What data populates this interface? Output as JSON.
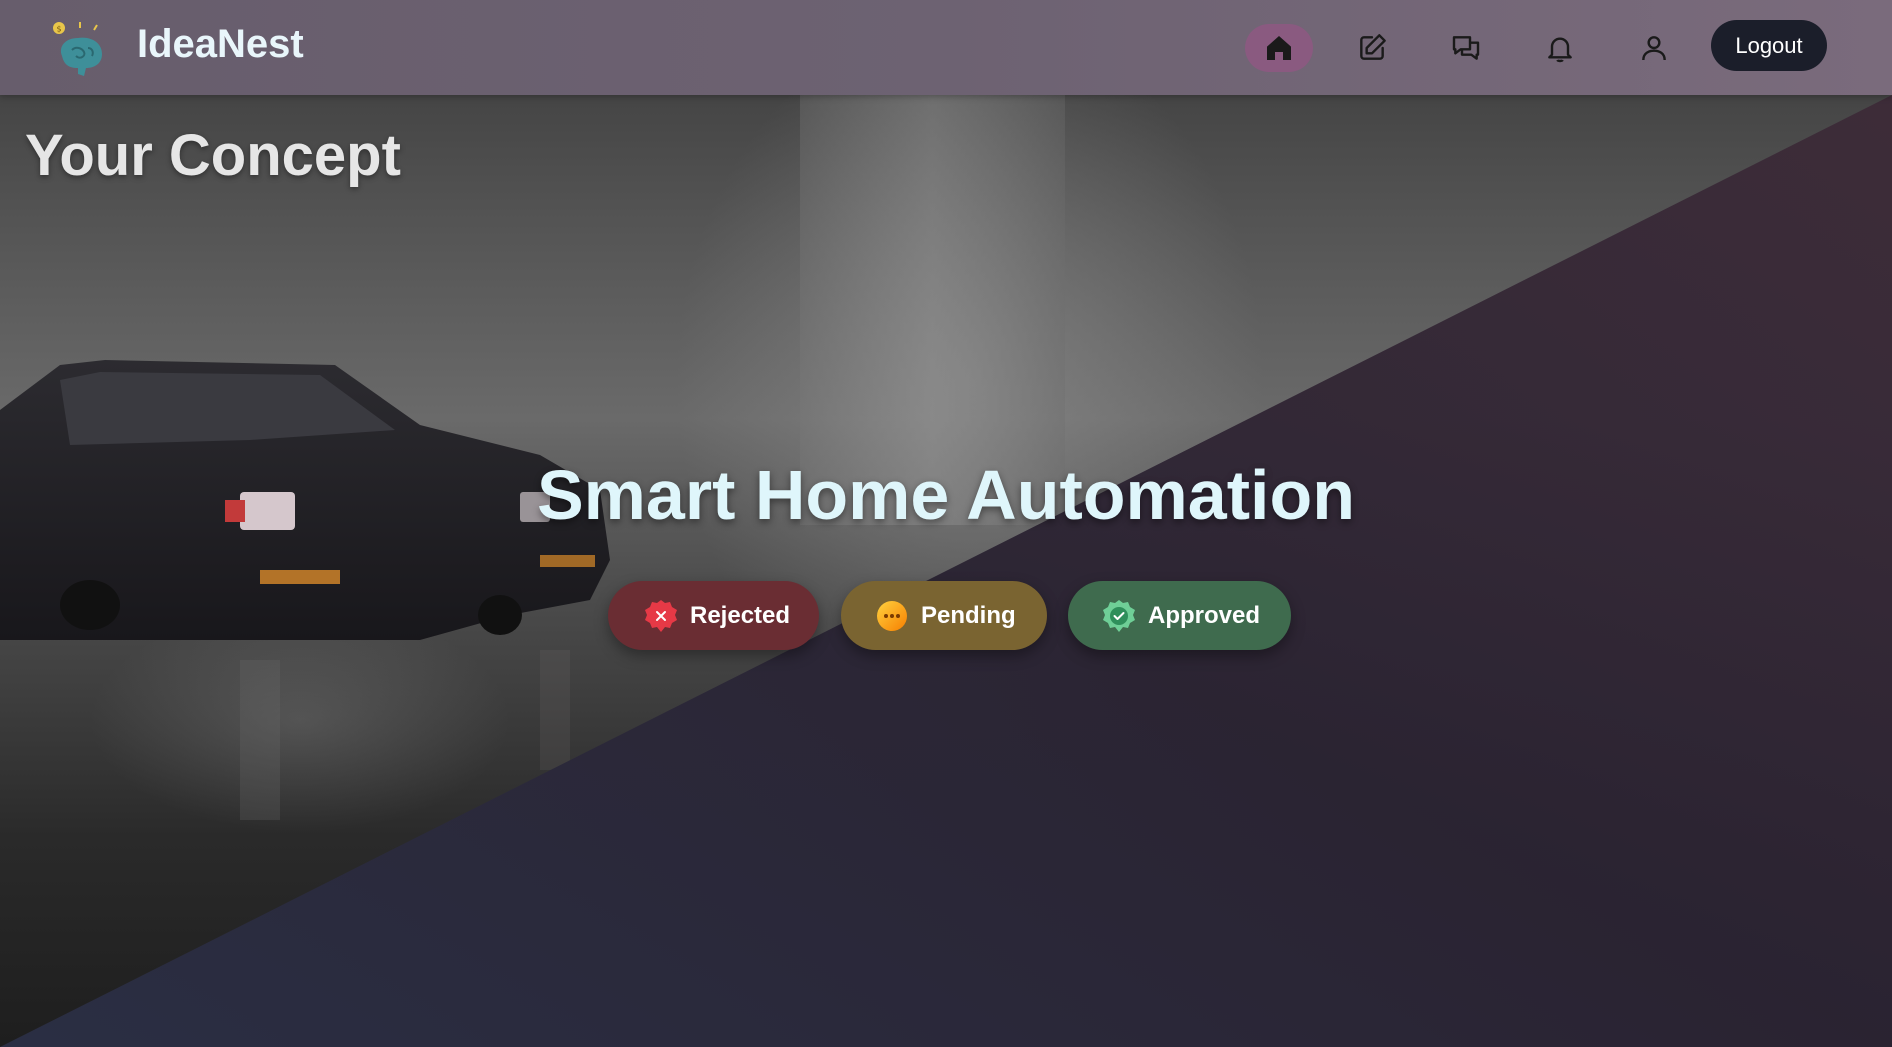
{
  "header": {
    "brand": "IdeaNest",
    "logout_label": "Logout",
    "nav": [
      {
        "icon": "home-icon",
        "active": true
      },
      {
        "icon": "edit-icon",
        "active": false
      },
      {
        "icon": "chat-icon",
        "active": false
      },
      {
        "icon": "bell-icon",
        "active": false
      },
      {
        "icon": "user-icon",
        "active": false
      }
    ]
  },
  "main": {
    "page_title": "Your Concept",
    "concept_title": "Smart Home Automation",
    "statuses": [
      {
        "label": "Rejected",
        "icon": "x-badge-icon",
        "color": "#6a2d33"
      },
      {
        "label": "Pending",
        "icon": "dots-icon",
        "color": "#7a6431"
      },
      {
        "label": "Approved",
        "icon": "check-badge-icon",
        "color": "#3f6b4e"
      }
    ]
  },
  "colors": {
    "header_bg": "#6d6272",
    "active_nav": "#8a5a80",
    "logout_bg": "#1b1e2a",
    "title_text": "#dff6fb"
  }
}
